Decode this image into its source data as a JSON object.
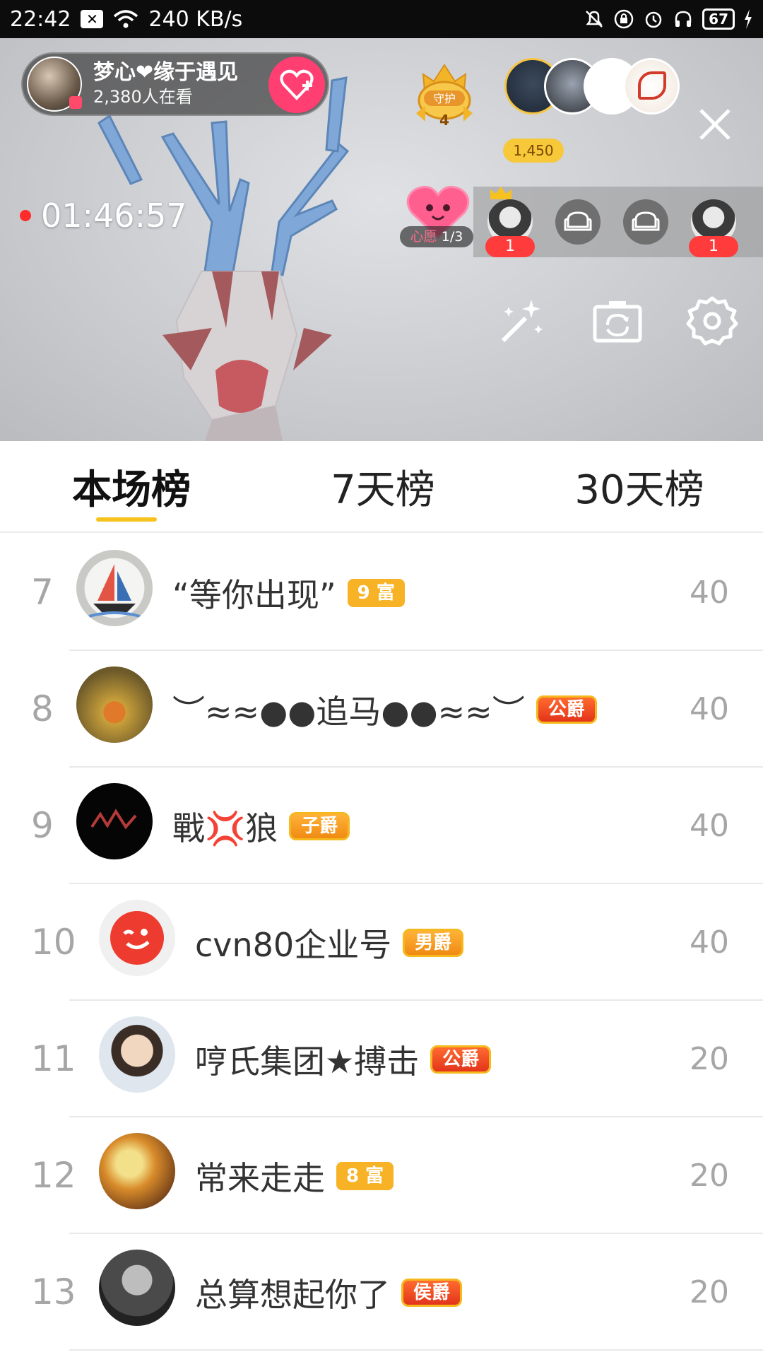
{
  "status_bar": {
    "time": "22:42",
    "speed": "240 KB/s",
    "battery": "67"
  },
  "live": {
    "host_name": "梦心❤缘于遇见",
    "viewers": "2,380人在看",
    "guard_label": "守护",
    "guard_count": "4",
    "top_score": "1,450",
    "timer": "01:46:57",
    "wish_prefix": "心愿",
    "wish_progress": "1/3",
    "mic_left_badge": "1",
    "mic_right_badge": "1"
  },
  "tabs": [
    {
      "label": "本场榜",
      "active": true
    },
    {
      "label": "7天榜",
      "active": false
    },
    {
      "label": "30天榜",
      "active": false
    }
  ],
  "ranking": [
    {
      "rank": "7",
      "name": "“等你出现”",
      "badge": "9 富",
      "score": "40"
    },
    {
      "rank": "8",
      "name": "︶≈≈●●追马●●≈≈︶",
      "badge": "公爵",
      "score": "40"
    },
    {
      "rank": "9",
      "name": "戰💢狼",
      "badge": "子爵",
      "score": "40"
    },
    {
      "rank": "10",
      "name": "cvn80企业号",
      "badge": "男爵",
      "score": "40"
    },
    {
      "rank": "11",
      "name": "哼氏集团★搏击",
      "badge": "公爵",
      "score": "20"
    },
    {
      "rank": "12",
      "name": "常来走走",
      "badge": "8 富",
      "score": "20"
    },
    {
      "rank": "13",
      "name": "总算想起你了",
      "badge": "侯爵",
      "score": "20"
    }
  ]
}
